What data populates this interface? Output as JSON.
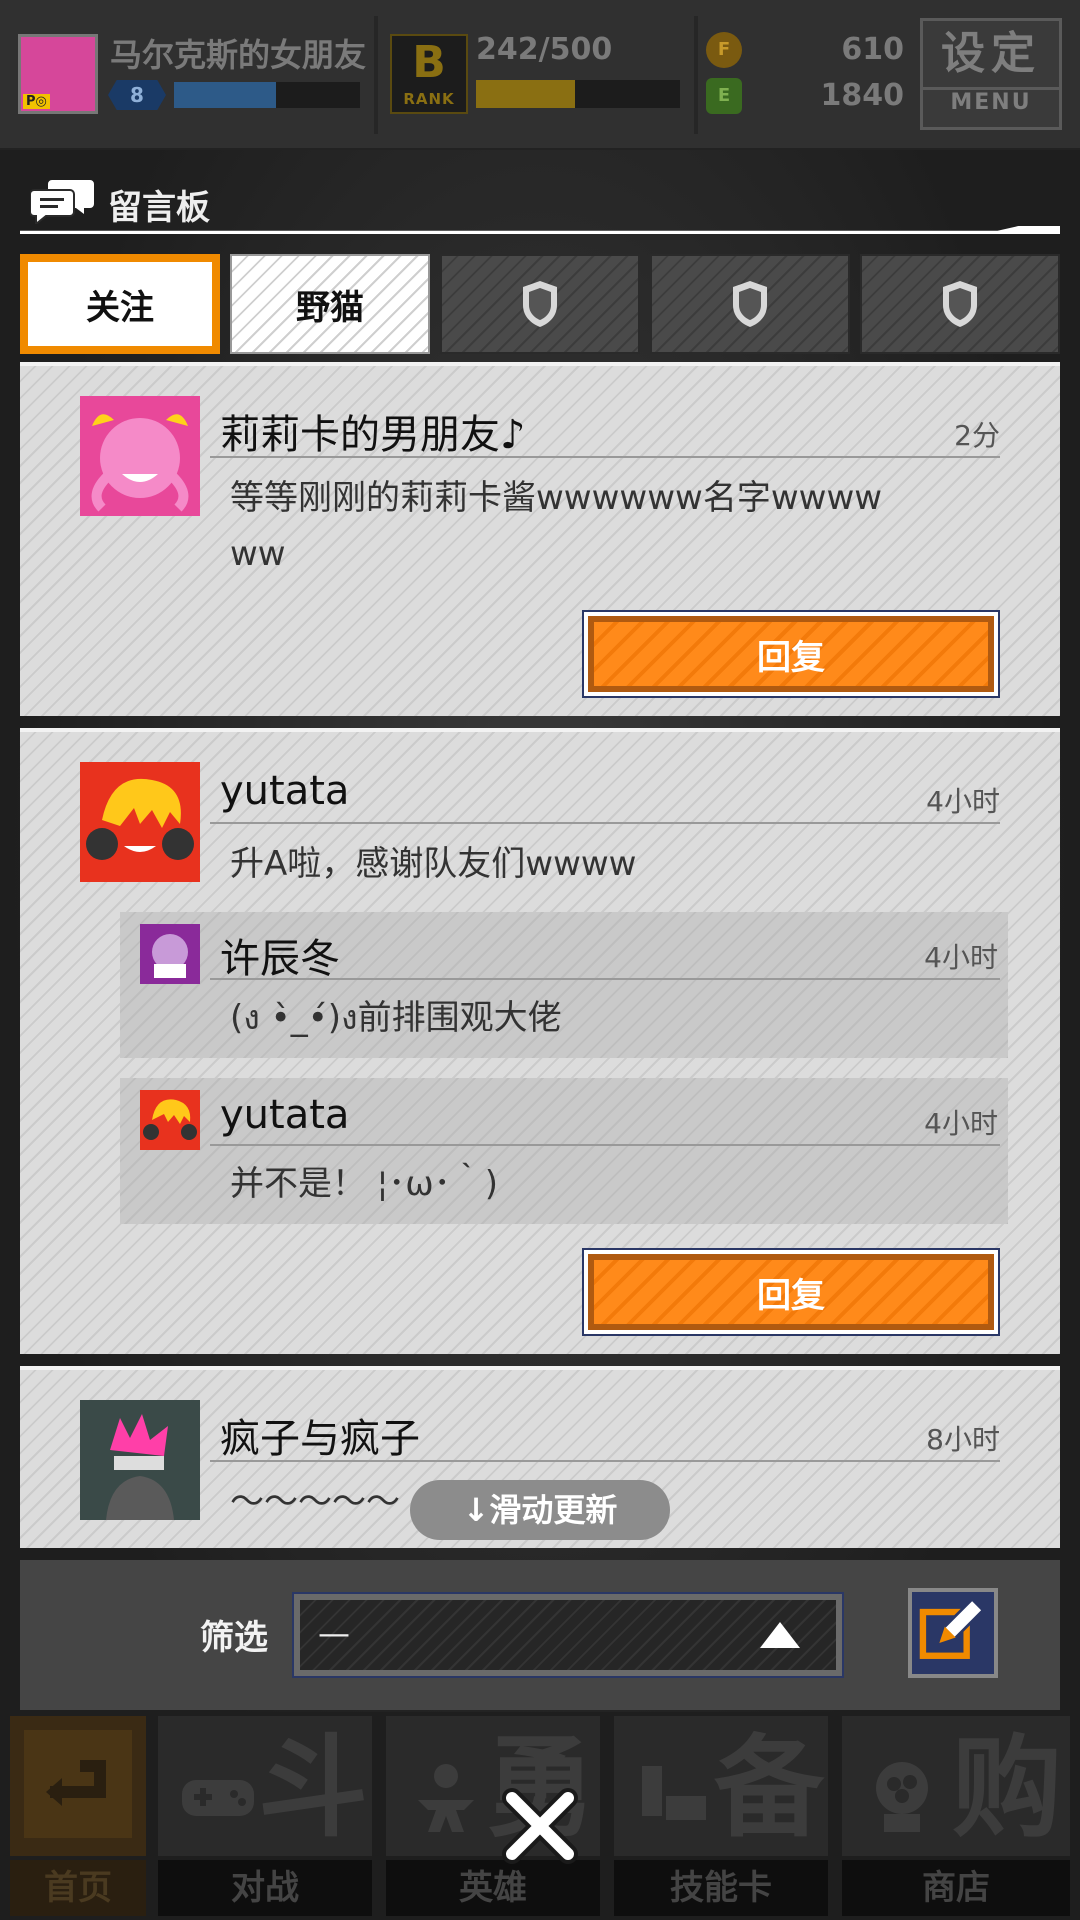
{
  "topbar": {
    "player_name": "马尔克斯的女朋友",
    "avatar_badge": "P◎",
    "level": "8",
    "exp_fraction": 0.55,
    "rank_letter": "B",
    "rank_word": "RANK",
    "rank_progress": "242/500",
    "rank_fraction": 0.484,
    "coin_f_symbol": "F",
    "coin_f": "610",
    "coin_e_symbol": "E",
    "coin_e": "1840",
    "settings_label": "设定",
    "settings_sub": "MENU"
  },
  "panel": {
    "title": "留言板"
  },
  "tabs": [
    {
      "label": "关注",
      "state": "active"
    },
    {
      "label": "野猫",
      "state": "normal"
    },
    {
      "label": "",
      "state": "locked",
      "icon": "shield-icon"
    },
    {
      "label": "",
      "state": "locked",
      "icon": "shield-icon"
    },
    {
      "label": "",
      "state": "locked",
      "icon": "shield-icon"
    }
  ],
  "posts": [
    {
      "author": "莉莉卡的男朋友♪",
      "time": "2分",
      "text_line1": "等等刚刚的莉莉卡酱wwwwww名字wwww",
      "text_line2": "ww",
      "avatar_color": "#e8489a",
      "reply_label": "回复"
    },
    {
      "author": "yutata",
      "time": "4小时",
      "text": "升A啦，感谢队友们wwww",
      "avatar_color": "#e8321e",
      "replies": [
        {
          "author": "许辰冬",
          "time": "4小时",
          "text": "(ง •̀_•́)ง前排围观大佬",
          "avatar_color": "#8a2a9a"
        },
        {
          "author": "yutata",
          "time": "4小时",
          "text": "并不是！ ¦･ω･｀)",
          "avatar_color": "#e8321e"
        }
      ],
      "reply_label": "回复"
    },
    {
      "author": "疯子与疯子",
      "time": "8小时",
      "text": "～～～～～",
      "avatar_color": "#3a4a48"
    }
  ],
  "pull_to_refresh": "↓滑动更新",
  "filter": {
    "label": "筛选",
    "value": "—"
  },
  "bottom_nav": [
    {
      "label": "首页",
      "big": ""
    },
    {
      "label": "对战",
      "big": "斗"
    },
    {
      "label": "英雄",
      "big": "勇"
    },
    {
      "label": "技能卡",
      "big": "备"
    },
    {
      "label": "商店",
      "big": "购"
    }
  ],
  "colors": {
    "accent_orange": "#f08a00",
    "button_orange": "#ff8a1a",
    "frame_navy": "#2a3766"
  }
}
